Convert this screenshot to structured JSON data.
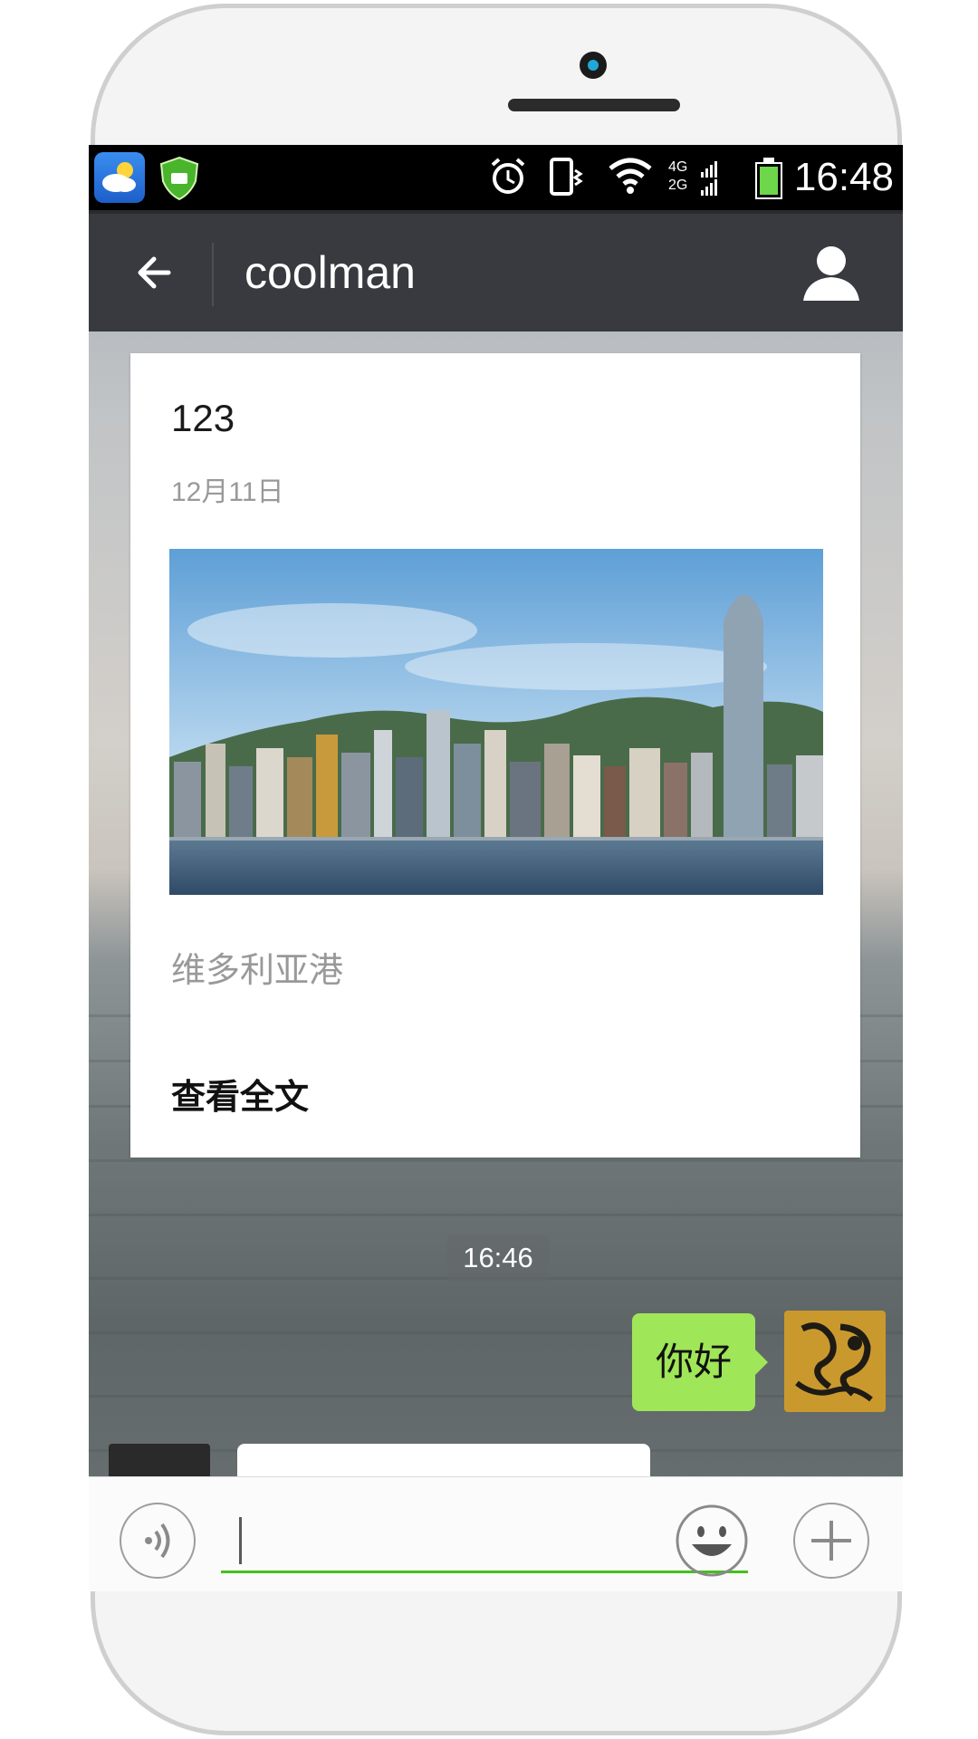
{
  "status_bar": {
    "time": "16:48",
    "network_label_top": "4G",
    "network_label_bottom": "2G",
    "icons": [
      "weather-app-icon",
      "security-app-icon",
      "alarm-icon",
      "vibrate-icon",
      "wifi-icon",
      "cell-signal-icon",
      "battery-icon"
    ]
  },
  "header": {
    "title": "coolman",
    "back_icon": "back-arrow-icon",
    "profile_icon": "person-icon"
  },
  "article_card": {
    "title": "123",
    "date": "12月11日",
    "description": "维多利亚港",
    "read_more": "查看全文"
  },
  "chat": {
    "timestamp": "16:46",
    "outgoing_message": "你好",
    "incoming_message_partial": ""
  },
  "composer": {
    "input_value": "",
    "voice_icon": "voice-icon",
    "emoji_icon": "emoji-icon",
    "more_icon": "plus-icon"
  },
  "colors": {
    "nav_bar": "#393a3f",
    "outgoing_bubble": "#9fe658",
    "input_underline": "#45c01a",
    "status_bar": "#000000"
  }
}
